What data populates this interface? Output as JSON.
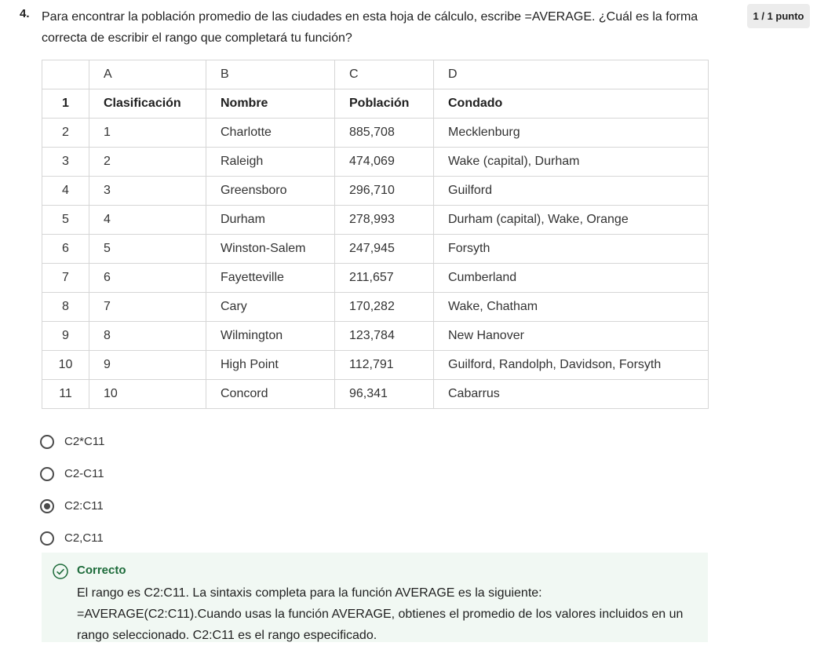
{
  "question": {
    "number": "4.",
    "prompt": "Para encontrar la población promedio de las ciudades en esta hoja de cálculo, escribe =AVERAGE. ¿Cuál es la forma correcta de escribir el rango que completará tu función?",
    "score": "1 / 1 punto"
  },
  "table": {
    "columns": [
      "",
      "A",
      "B",
      "C",
      "D"
    ],
    "rows": [
      [
        "1",
        "Clasificación",
        "Nombre",
        "Población",
        "Condado"
      ],
      [
        "2",
        "1",
        "Charlotte",
        "885,708",
        "Mecklenburg"
      ],
      [
        "3",
        "2",
        "Raleigh",
        "474,069",
        "Wake (capital), Durham"
      ],
      [
        "4",
        "3",
        "Greensboro",
        "296,710",
        "Guilford"
      ],
      [
        "5",
        "4",
        "Durham",
        "278,993",
        "Durham (capital), Wake, Orange"
      ],
      [
        "6",
        "5",
        "Winston-Salem",
        "247,945",
        "Forsyth"
      ],
      [
        "7",
        "6",
        "Fayetteville",
        "211,657",
        "Cumberland"
      ],
      [
        "8",
        "7",
        "Cary",
        "170,282",
        "Wake, Chatham"
      ],
      [
        "9",
        "8",
        "Wilmington",
        "123,784",
        "New Hanover"
      ],
      [
        "10",
        "9",
        "High Point",
        "112,791",
        "Guilford, Randolph, Davidson, Forsyth"
      ],
      [
        "11",
        "10",
        "Concord",
        "96,341",
        "Cabarrus"
      ]
    ]
  },
  "options": [
    {
      "label": "C2*C11",
      "selected": false
    },
    {
      "label": "C2-C11",
      "selected": false
    },
    {
      "label": "C2:C11",
      "selected": true
    },
    {
      "label": "C2,C11",
      "selected": false
    }
  ],
  "feedback": {
    "title": "Correcto",
    "text": "El rango es C2:C11. La sintaxis completa para la función AVERAGE es la siguiente: =AVERAGE(C2:C11).Cuando usas la función AVERAGE, obtienes el promedio de los valores incluidos en un rango seleccionado. C2:C11 es el rango especificado.",
    "icon": "check-circle-icon",
    "accent_color": "#1d6b3a",
    "background_color": "#f1f8f3"
  }
}
